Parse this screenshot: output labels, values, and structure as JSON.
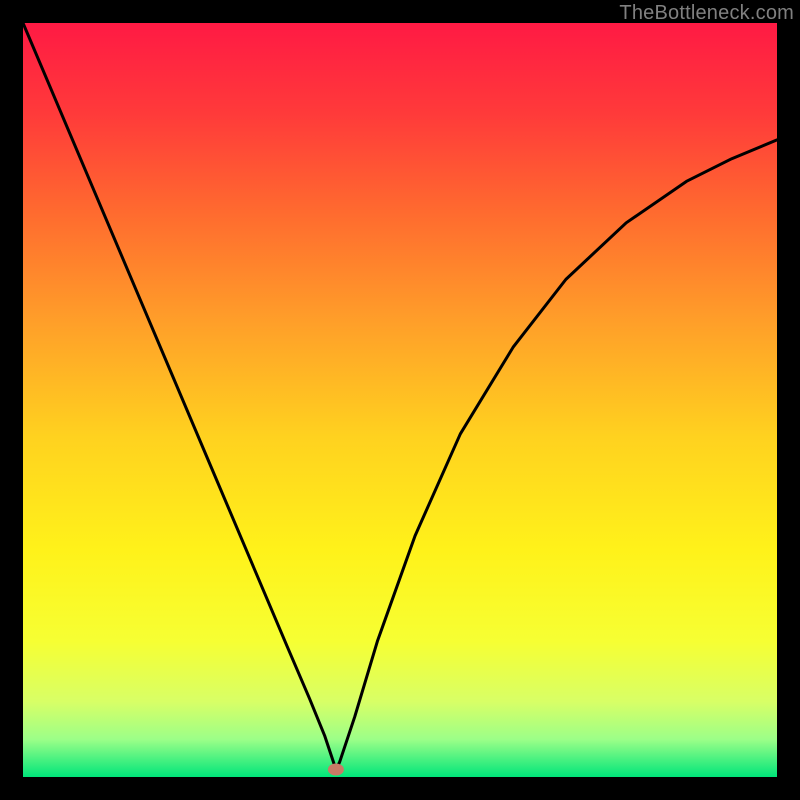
{
  "watermark": "TheBottleneck.com",
  "chart_data": {
    "type": "line",
    "title": "",
    "xlabel": "",
    "ylabel": "",
    "xlim": [
      0,
      1
    ],
    "ylim": [
      0,
      1
    ],
    "background_gradient": {
      "stops": [
        {
          "offset": 0.0,
          "color": "#ff1a44"
        },
        {
          "offset": 0.12,
          "color": "#ff3a3a"
        },
        {
          "offset": 0.25,
          "color": "#ff6a2f"
        },
        {
          "offset": 0.4,
          "color": "#ffa029"
        },
        {
          "offset": 0.55,
          "color": "#ffd21f"
        },
        {
          "offset": 0.7,
          "color": "#fff21a"
        },
        {
          "offset": 0.82,
          "color": "#f6ff33"
        },
        {
          "offset": 0.9,
          "color": "#d8ff66"
        },
        {
          "offset": 0.95,
          "color": "#9cff88"
        },
        {
          "offset": 1.0,
          "color": "#00e57a"
        }
      ]
    },
    "series": [
      {
        "name": "bottleneck-curve",
        "type": "line",
        "x": [
          0.0,
          0.05,
          0.1,
          0.15,
          0.2,
          0.25,
          0.3,
          0.35,
          0.38,
          0.4,
          0.41,
          0.415,
          0.42,
          0.44,
          0.47,
          0.52,
          0.58,
          0.65,
          0.72,
          0.8,
          0.88,
          0.94,
          1.0
        ],
        "y": [
          1.0,
          0.882,
          0.764,
          0.646,
          0.528,
          0.41,
          0.292,
          0.174,
          0.104,
          0.055,
          0.025,
          0.01,
          0.02,
          0.08,
          0.18,
          0.32,
          0.455,
          0.57,
          0.66,
          0.735,
          0.79,
          0.82,
          0.845
        ]
      }
    ],
    "marker": {
      "name": "optimal-point",
      "x": 0.415,
      "y": 0.01,
      "color": "#c97a66",
      "rx": 8,
      "ry": 6
    }
  }
}
